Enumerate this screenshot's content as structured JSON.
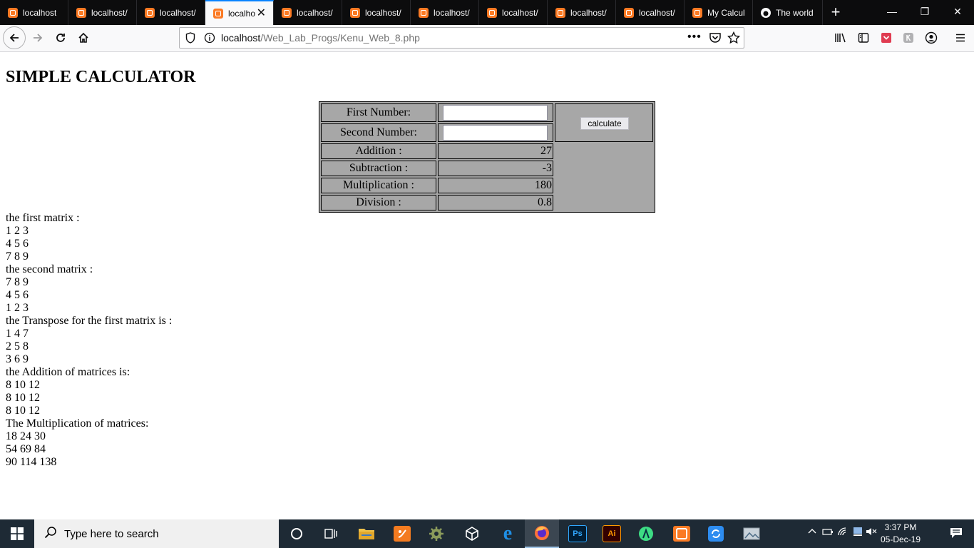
{
  "browser": {
    "tabs": [
      {
        "label": "localhost",
        "icon": "xampp-icon",
        "active": false
      },
      {
        "label": "localhost/",
        "icon": "xampp-icon",
        "active": false
      },
      {
        "label": "localhost/",
        "icon": "xampp-icon",
        "active": false
      },
      {
        "label": "localhost",
        "icon": "xampp-icon",
        "active": true
      },
      {
        "label": "localhost/",
        "icon": "xampp-icon",
        "active": false
      },
      {
        "label": "localhost/",
        "icon": "xampp-icon",
        "active": false
      },
      {
        "label": "localhost/",
        "icon": "xampp-icon",
        "active": false
      },
      {
        "label": "localhost/",
        "icon": "xampp-icon",
        "active": false
      },
      {
        "label": "localhost/",
        "icon": "xampp-icon",
        "active": false
      },
      {
        "label": "localhost/",
        "icon": "xampp-icon",
        "active": false
      },
      {
        "label": "My Calcul",
        "icon": "xampp-icon",
        "active": false
      },
      {
        "label": "The world",
        "icon": "github-icon",
        "active": false
      }
    ],
    "url_host": "localhost",
    "url_path": "/Web_Lab_Progs/Kenu_Web_8.php",
    "accent_color": "#0a84ff"
  },
  "page": {
    "title": "SIMPLE CALCULATOR",
    "calculator": {
      "first_label": "First Number:",
      "second_label": "Second Number:",
      "button_label": "calculate",
      "addition_label": "Addition :",
      "addition_value": "27",
      "subtraction_label": "Subtraction :",
      "subtraction_value": "-3",
      "multiplication_label": "Multiplication :",
      "multiplication_value": "180",
      "division_label": "Division :",
      "division_value": "0.8",
      "first_value": "",
      "second_value": ""
    },
    "output_lines": [
      "the first matrix :",
      "1 2 3",
      "4 5 6",
      "7 8 9",
      "the second matrix :",
      "7 8 9",
      "4 5 6",
      "1 2 3",
      "the Transpose for the first matrix is :",
      "1 4 7",
      "2 5 8",
      "3 6 9",
      "the Addition of matrices is:",
      "8 10 12",
      "8 10 12",
      "8 10 12",
      "The Multiplication of matrices:",
      "18 24 30",
      "54 69 84",
      "90 114 138"
    ]
  },
  "taskbar": {
    "search_placeholder": "Type here to search",
    "time": "3:37 PM",
    "date": "05-Dec-19",
    "apps": [
      "cortana-icon",
      "task-view-icon",
      "file-explorer-icon",
      "paint-app-icon",
      "settings-icon",
      "unity-icon",
      "edge-icon",
      "firefox-icon",
      "photoshop-icon",
      "illustrator-icon",
      "android-studio-icon",
      "xampp-icon",
      "sync-app-icon",
      "photos-app-icon"
    ],
    "ps_label": "Ps",
    "ai_label": "Ai"
  }
}
